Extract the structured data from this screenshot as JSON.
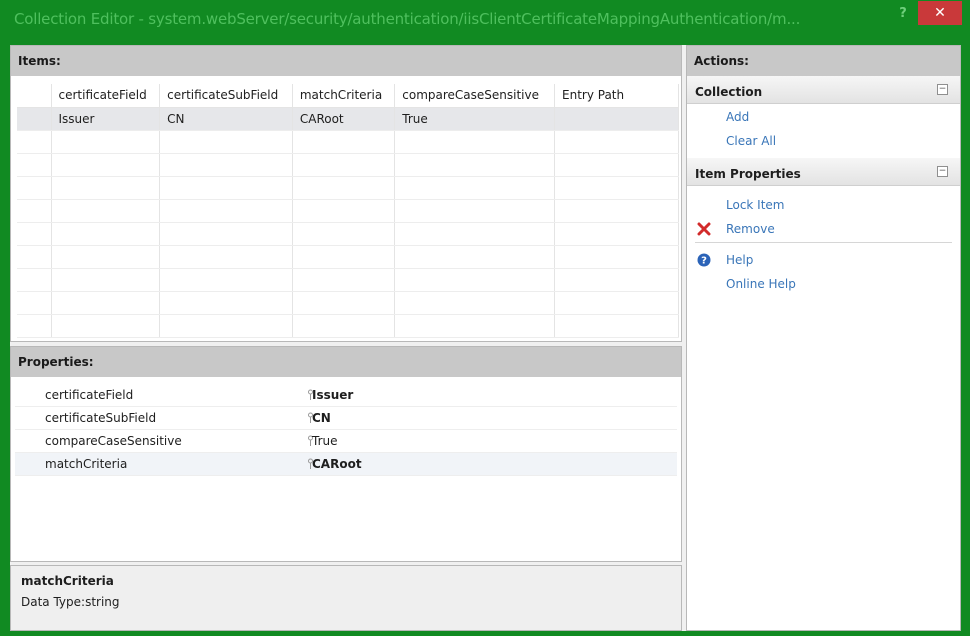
{
  "window": {
    "title": "Collection Editor - system.webServer/security/authentication/iisClientCertificateMappingAuthentication/m...",
    "help_label": "?",
    "close_label": "✕"
  },
  "items": {
    "header": "Items:",
    "columns": [
      "certificateField",
      "certificateSubField",
      "matchCriteria",
      "compareCaseSensitive",
      "Entry Path"
    ],
    "rows": [
      [
        "Issuer",
        "CN",
        "CARoot",
        "True",
        ""
      ]
    ]
  },
  "properties": {
    "header": "Properties:",
    "rows": [
      {
        "name": "certificateField",
        "value": "Issuer",
        "bold": true
      },
      {
        "name": "certificateSubField",
        "value": "CN",
        "bold": true
      },
      {
        "name": "compareCaseSensitive",
        "value": "True",
        "bold": false
      },
      {
        "name": "matchCriteria",
        "value": "CARoot",
        "bold": true
      }
    ]
  },
  "description": {
    "title": "matchCriteria",
    "type": "Data Type:string"
  },
  "actions": {
    "header": "Actions:",
    "collection": {
      "title": "Collection",
      "items": [
        "Add",
        "Clear All"
      ]
    },
    "item_properties": {
      "title": "Item Properties",
      "items": [
        "Lock Item",
        "Remove"
      ]
    },
    "help": [
      "Help",
      "Online Help"
    ]
  },
  "colors": {
    "frame": "#118a22",
    "link": "#3a76b8",
    "close": "#c9393a"
  }
}
